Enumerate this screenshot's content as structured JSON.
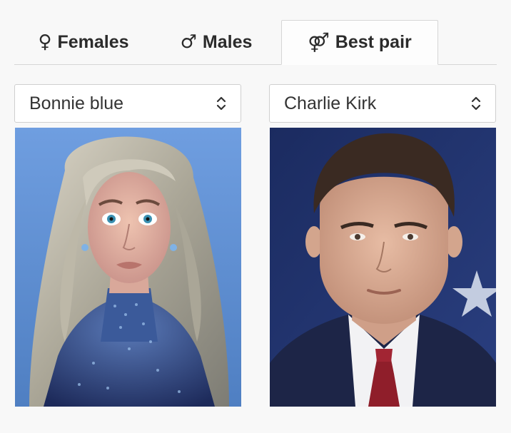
{
  "tabs": [
    {
      "symbol": "♀",
      "label": "Females",
      "icon": "female-symbol-icon"
    },
    {
      "symbol": "♂",
      "label": "Males",
      "icon": "male-symbol-icon"
    },
    {
      "symbol": "⚤",
      "label": "Best pair",
      "icon": "pair-symbol-icon",
      "active": true
    }
  ],
  "selects": {
    "left": {
      "value": "Bonnie blue"
    },
    "right": {
      "value": "Charlie Kirk"
    }
  },
  "colors": {
    "background": "#f8f8f8",
    "tab_border": "#d6d6d6",
    "text": "#2b2b2b",
    "left_photo_bg": "#5b8fd0",
    "right_photo_bg": "#1f3470"
  }
}
